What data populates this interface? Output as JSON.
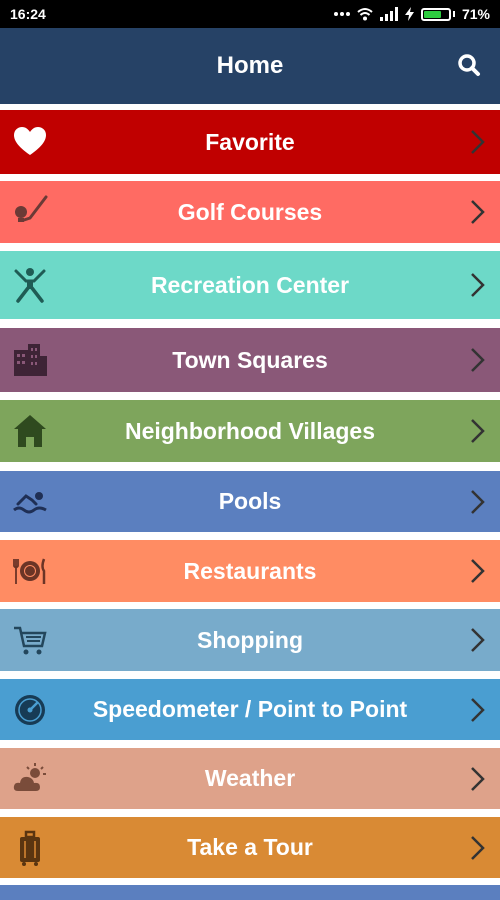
{
  "status_bar": {
    "time": "16:24",
    "battery": "71%",
    "battery_level": 0.71
  },
  "header": {
    "title": "Home",
    "search_icon": "search-icon"
  },
  "colors": {
    "header": "#264266",
    "favorite": "#c00000",
    "golf": "#ff6b63",
    "recreation": "#6dd9c8",
    "town_squares": "#8a5878",
    "villages": "#7ea55c",
    "pools": "#5b7fbf",
    "restaurants": "#ff8c63",
    "shopping": "#78abcb",
    "speedometer": "#4a9ed1",
    "weather": "#dea28a",
    "tour": "#d98a34"
  },
  "menu": [
    {
      "label": "Favorite",
      "icon": "heart-icon"
    },
    {
      "label": "Golf Courses",
      "icon": "golf-icon"
    },
    {
      "label": "Recreation Center",
      "icon": "person-icon"
    },
    {
      "label": "Town Squares",
      "icon": "buildings-icon"
    },
    {
      "label": "Neighborhood Villages",
      "icon": "house-icon"
    },
    {
      "label": "Pools",
      "icon": "swimmer-icon"
    },
    {
      "label": "Restaurants",
      "icon": "dining-icon"
    },
    {
      "label": "Shopping",
      "icon": "cart-icon"
    },
    {
      "label": "Speedometer / Point to Point",
      "icon": "gauge-icon"
    },
    {
      "label": "Weather",
      "icon": "weather-icon"
    },
    {
      "label": "Take a Tour",
      "icon": "luggage-icon"
    }
  ]
}
